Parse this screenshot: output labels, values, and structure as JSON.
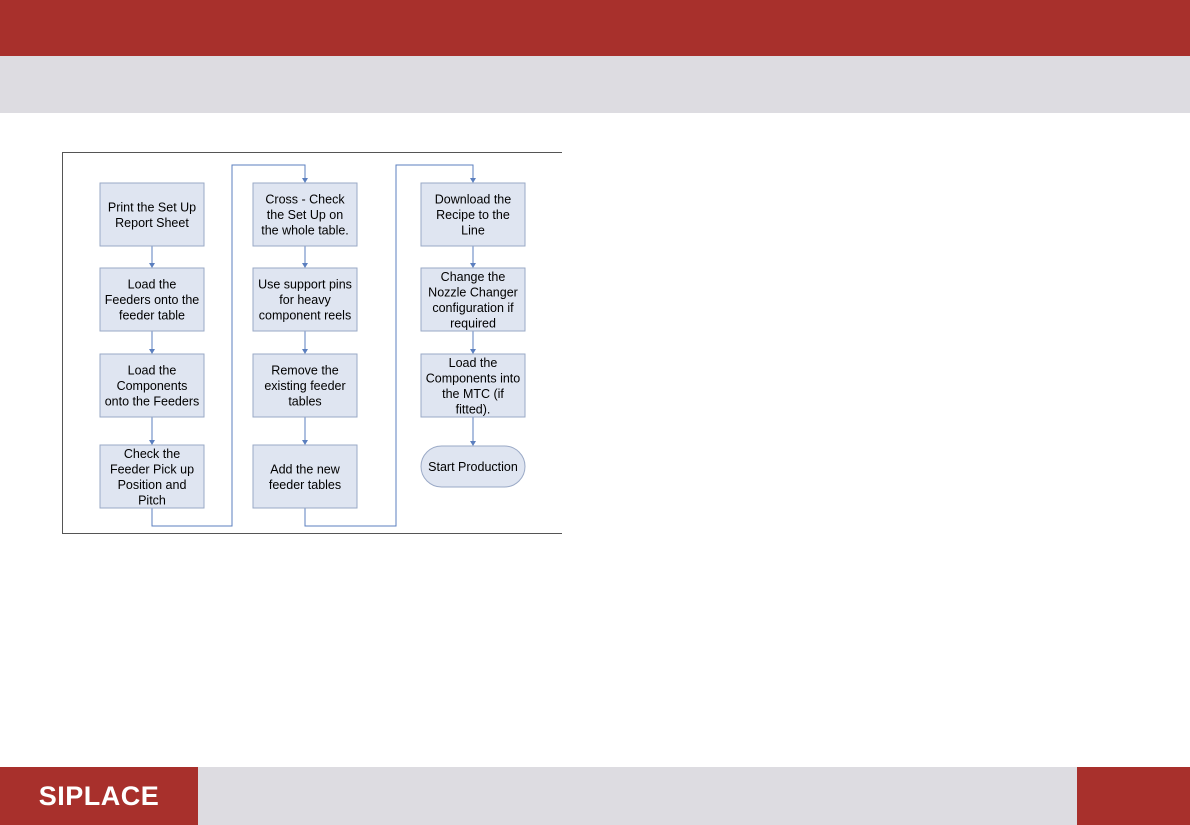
{
  "brand": {
    "logo_text": "SIPLACE"
  },
  "flowchart": {
    "columns": [
      {
        "steps": [
          [
            "Print the Set Up",
            "Report Sheet"
          ],
          [
            "Load the",
            "Feeders onto the",
            "feeder table"
          ],
          [
            "Load the",
            "Components",
            "onto the Feeders"
          ],
          [
            "Check the",
            "Feeder Pick up",
            "Position and",
            "Pitch"
          ]
        ]
      },
      {
        "steps": [
          [
            "Cross - Check",
            "the Set Up on",
            "the whole table."
          ],
          [
            "Use support pins",
            "for heavy",
            "component reels"
          ],
          [
            "Remove the",
            "existing feeder",
            "tables"
          ],
          [
            "Add the new",
            "feeder tables"
          ]
        ]
      },
      {
        "steps": [
          [
            "Download the",
            "Recipe to the",
            "Line"
          ],
          [
            "Change the",
            "Nozzle Changer",
            "configuration if",
            "required"
          ],
          [
            "Load the",
            "Components into",
            "the MTC (if",
            "fitted)."
          ]
        ],
        "terminal": [
          "Start Production"
        ]
      }
    ],
    "colors": {
      "box_fill": "#dfe5f1",
      "box_stroke": "#9aa9c6",
      "connector": "#5b7fbf",
      "terminal_fill": "#dfe5f1"
    }
  }
}
